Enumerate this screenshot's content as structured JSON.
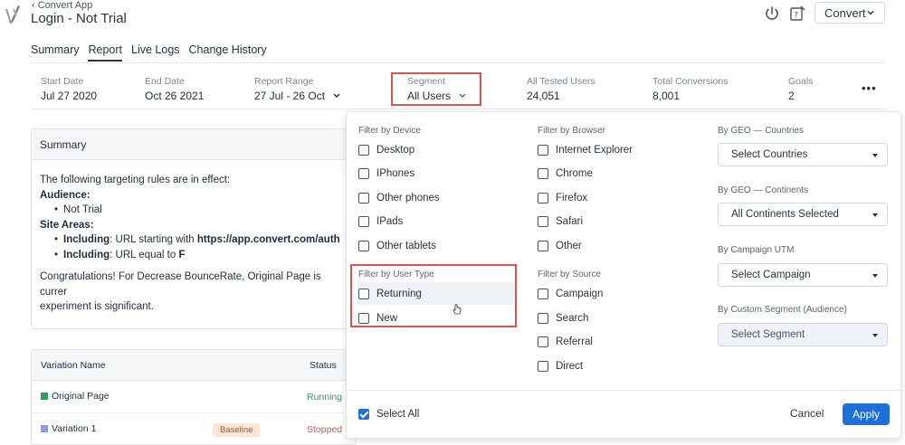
{
  "header": {
    "back_link": "Convert App",
    "title": "Login - Not Trial",
    "account_button": "Convert"
  },
  "tabs": [
    {
      "label": "Summary"
    },
    {
      "label": "Report"
    },
    {
      "label": "Live Logs"
    },
    {
      "label": "Change History"
    }
  ],
  "metrics": {
    "start_date": {
      "label": "Start Date",
      "value": "Jul 27 2020"
    },
    "end_date": {
      "label": "End Date",
      "value": "Oct 26 2021"
    },
    "report_range": {
      "label": "Report Range",
      "value": "27 Jul - 26 Oct"
    },
    "segment": {
      "label": "Segment",
      "value": "All Users"
    },
    "tested_users": {
      "label": "All Tested Users",
      "value": "24,051"
    },
    "conversions": {
      "label": "Total Conversions",
      "value": "8,001"
    },
    "goals": {
      "label": "Goals",
      "value": "2"
    },
    "more": "•••"
  },
  "summary": {
    "heading": "Summary",
    "intro": "The following targeting rules are in effect:",
    "audience_label": "Audience:",
    "audience_item": "Not Trial",
    "site_areas_label": "Site Areas:",
    "rule1_prefix": "Including",
    "rule1_text": ": URL starting with ",
    "rule1_value": "https://app.convert.com/auth",
    "rule2_prefix": "Including",
    "rule2_text": ": URL equal to ",
    "rule2_value": "F",
    "congrats_line1": "Congratulations! For Decrease BounceRate, Original Page is currer",
    "congrats_line2": "experiment is significant."
  },
  "variations": {
    "col_name": "Variation Name",
    "col_status": "Status",
    "rows": [
      {
        "name": "Original Page",
        "status": "Running",
        "color": "#2e9e5b",
        "status_color": "#2e9e5b"
      },
      {
        "name": "Variation 1",
        "badge": "Baseline",
        "status": "Stopped",
        "color": "#8a9be8",
        "status_color": "#d9534f"
      }
    ]
  },
  "filters": {
    "device": {
      "label": "Filter by Device",
      "options": [
        "Desktop",
        "IPhones",
        "Other phones",
        "IPads",
        "Other tablets"
      ]
    },
    "browser": {
      "label": "Filter by Browser",
      "options": [
        "Internet Explorer",
        "Chrome",
        "Firefox",
        "Safari",
        "Other"
      ]
    },
    "user_type": {
      "label": "Filter by User Type",
      "options": [
        "Returning",
        "New"
      ]
    },
    "source": {
      "label": "Filter by Source",
      "options": [
        "Campaign",
        "Search",
        "Referral",
        "Direct"
      ]
    },
    "geo_countries": {
      "label": "By GEO — Countries",
      "value": "Select Countries"
    },
    "geo_continents": {
      "label": "By GEO — Continents",
      "value": "All Continents Selected"
    },
    "campaign_utm": {
      "label": "By Campaign UTM",
      "value": "Select Campaign"
    },
    "custom_segment": {
      "label": "By Custom Segment (Audience)",
      "value": "Select Segment"
    },
    "select_all": "Select All",
    "cancel": "Cancel",
    "apply": "Apply"
  },
  "colors": {
    "accent": "#1e6fd9",
    "highlight": "#d9534f"
  }
}
